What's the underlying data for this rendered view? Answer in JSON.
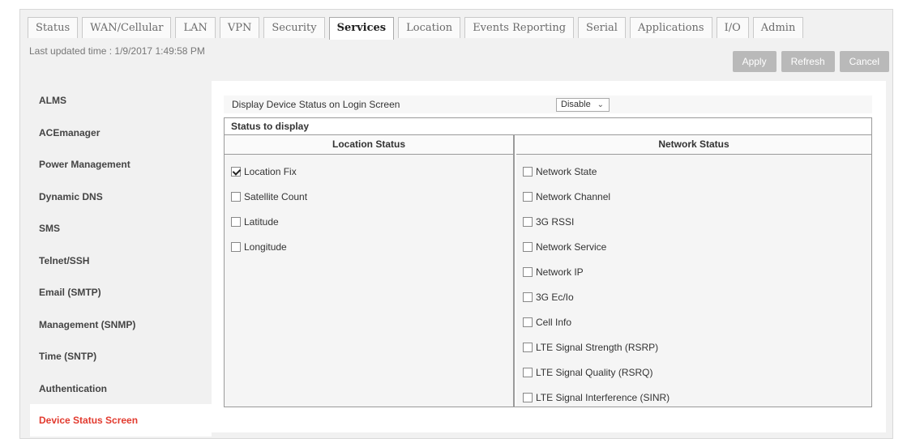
{
  "tabs": [
    "Status",
    "WAN/Cellular",
    "LAN",
    "VPN",
    "Security",
    "Services",
    "Location",
    "Events Reporting",
    "Serial",
    "Applications",
    "I/O",
    "Admin"
  ],
  "active_tab": "Services",
  "last_updated": "Last updated time : 1/9/2017 1:49:58 PM",
  "buttons": {
    "apply": "Apply",
    "refresh": "Refresh",
    "cancel": "Cancel"
  },
  "sidebar": [
    "ALMS",
    "ACEmanager",
    "Power Management",
    "Dynamic DNS",
    "SMS",
    "Telnet/SSH",
    "Email (SMTP)",
    "Management (SNMP)",
    "Time (SNTP)",
    "Authentication",
    "Device Status Screen"
  ],
  "sidebar_active": "Device Status Screen",
  "display_status": {
    "label": "Display Device Status on Login Screen",
    "value": "Disable"
  },
  "status_to_display": "Status to display",
  "location_status": {
    "title": "Location Status",
    "items": [
      {
        "label": "Location Fix",
        "checked": true
      },
      {
        "label": "Satellite Count",
        "checked": false
      },
      {
        "label": "Latitude",
        "checked": false
      },
      {
        "label": "Longitude",
        "checked": false
      }
    ]
  },
  "network_status": {
    "title": "Network Status",
    "items": [
      {
        "label": "Network State",
        "checked": false
      },
      {
        "label": "Network Channel",
        "checked": false
      },
      {
        "label": "3G RSSI",
        "checked": false
      },
      {
        "label": "Network Service",
        "checked": false
      },
      {
        "label": "Network IP",
        "checked": false
      },
      {
        "label": "3G Ec/Io",
        "checked": false
      },
      {
        "label": "Cell Info",
        "checked": false
      },
      {
        "label": "LTE Signal Strength (RSRP)",
        "checked": false
      },
      {
        "label": "LTE Signal Quality (RSRQ)",
        "checked": false
      },
      {
        "label": "LTE Signal Interference (SINR)",
        "checked": false
      }
    ]
  }
}
